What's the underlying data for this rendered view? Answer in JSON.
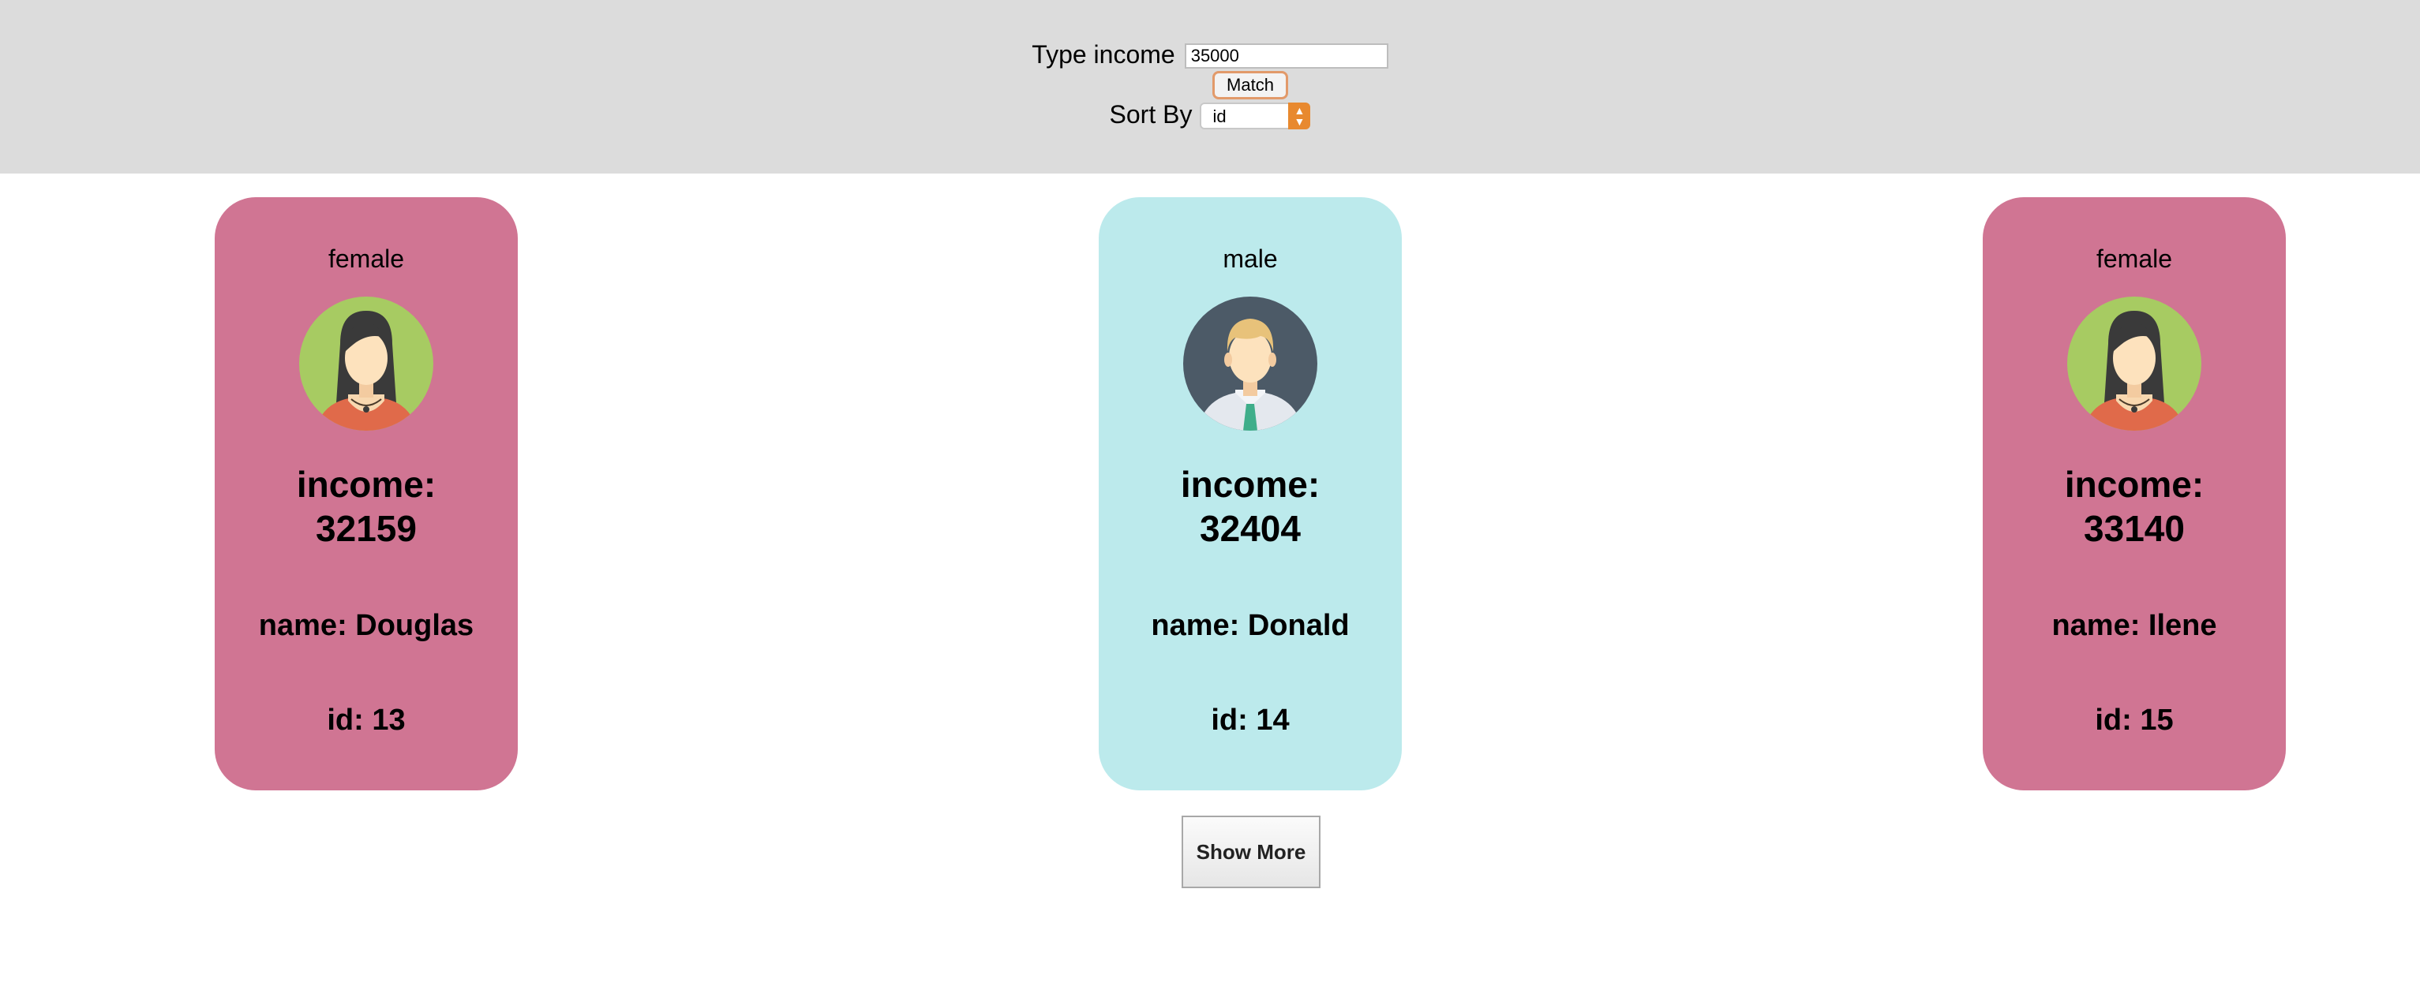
{
  "filter": {
    "income_label": "Type income",
    "income_value": "35000",
    "match_label": "Match",
    "sort_label": "Sort By",
    "sort_value": "id"
  },
  "cards": [
    {
      "gender": "female",
      "income_label": "income:",
      "income": "32159",
      "name": "name: Douglas",
      "id": "id: 13",
      "color": "#d07593",
      "avatar": "female-avatar-icon"
    },
    {
      "gender": "male",
      "income_label": "income:",
      "income": "32404",
      "name": "name: Donald",
      "id": "id: 14",
      "color": "#bceaec",
      "avatar": "male-avatar-icon"
    },
    {
      "gender": "female",
      "income_label": "income:",
      "income": "33140",
      "name": "name: Ilene",
      "id": "id: 15",
      "color": "#d07593",
      "avatar": "female-avatar-icon"
    }
  ],
  "show_more_label": "Show More",
  "colors": {
    "topbar": "#dcdcdc",
    "select_accent": "#e8892f",
    "match_border": "#e29a6a"
  }
}
